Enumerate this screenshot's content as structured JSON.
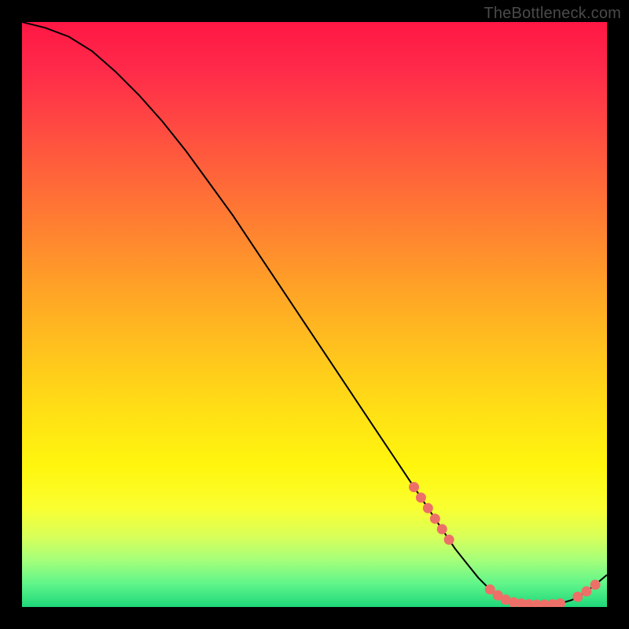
{
  "attribution": "TheBottleneck.com",
  "chart_data": {
    "type": "line",
    "title": "",
    "xlabel": "",
    "ylabel": "",
    "xlim": [
      0,
      100
    ],
    "ylim": [
      0,
      100
    ],
    "curve": {
      "x": [
        0,
        4,
        8,
        12,
        16,
        20,
        24,
        28,
        32,
        36,
        40,
        44,
        48,
        52,
        56,
        60,
        64,
        68,
        72,
        74,
        76,
        78,
        80,
        82,
        84,
        86,
        88,
        90,
        92,
        94,
        96,
        98,
        100
      ],
      "y": [
        100,
        99,
        97.5,
        95,
        91.5,
        87.5,
        83,
        78,
        72.5,
        67,
        61,
        55,
        49,
        43,
        37,
        31,
        25,
        19,
        13,
        10,
        7.5,
        5,
        3,
        1.5,
        0.8,
        0.5,
        0.4,
        0.4,
        0.6,
        1.2,
        2.3,
        3.8,
        5.5
      ]
    },
    "marker_clusters": [
      {
        "x_range": [
          67,
          73
        ],
        "y_range": [
          11,
          21
        ],
        "count": 6
      },
      {
        "x_range": [
          80,
          92
        ],
        "y_range": [
          0.3,
          1.5
        ],
        "count": 10
      },
      {
        "x_range": [
          95,
          98
        ],
        "y_range": [
          2.3,
          4.8
        ],
        "count": 3
      }
    ],
    "background_gradient": {
      "top": "#ff1744",
      "mid": "#ffe314",
      "bottom": "#1fd87a"
    },
    "notes": "Axes are unlabeled in the source image; curve and marker values are estimated from pixel positions on a 0–100 normalized scale. Line descends from top-left, bottoms out near x≈88, then rises slightly toward x=100."
  }
}
